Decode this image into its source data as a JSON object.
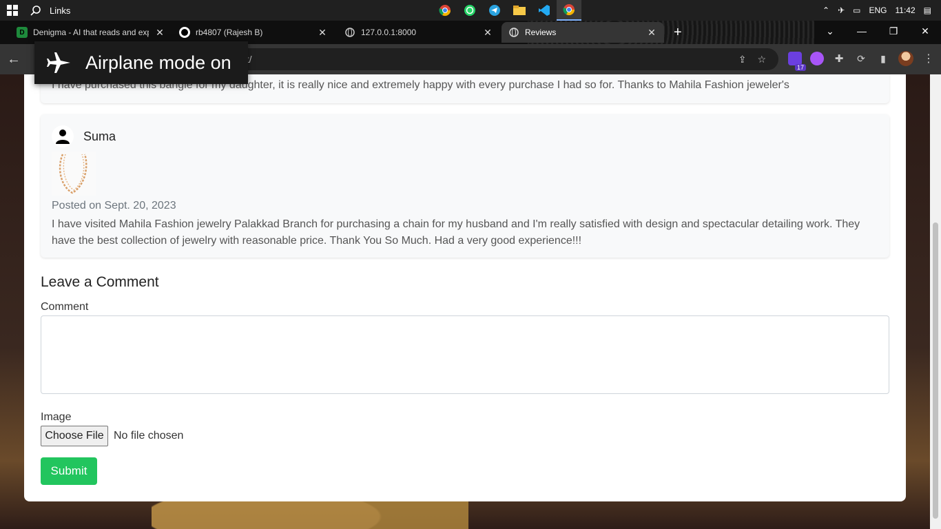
{
  "taskbar": {
    "search_label": "Links",
    "tray": {
      "language": "ENG",
      "time": "11:42"
    }
  },
  "tabs": [
    {
      "title": "Denigma - AI that reads and exp",
      "favicon": "D"
    },
    {
      "title": "rb4807 (Rajesh B)"
    },
    {
      "title": "127.0.0.1:8000"
    },
    {
      "title": "Reviews"
    }
  ],
  "toolbar": {
    "url_fragment": "nt/",
    "extension_badge": "17"
  },
  "toast": {
    "text": "Airplane mode on"
  },
  "reviews": [
    {
      "text": "I have purchased this bangle for my daughter, it is really nice and extremely happy with every purchase I had so for. Thanks to Mahila Fashion jeweler's"
    },
    {
      "name": "Suma",
      "posted": "Posted on Sept. 20, 2023",
      "text": "I have visited Mahila Fashion jewelry Palakkad Branch for purchasing a chain for my husband and I'm really satisfied with design and spectacular detailing work. They have the best collection of jewelry with reasonable price. Thank You So Much. Had a very good experience!!!"
    }
  ],
  "form": {
    "title": "Leave a Comment",
    "comment_label": "Comment",
    "comment_value": "",
    "image_label": "Image",
    "choose_file": "Choose File",
    "no_file": "No file chosen",
    "submit": "Submit"
  },
  "colors": {
    "submit": "#22c55e",
    "badge": "#5b36c5"
  }
}
